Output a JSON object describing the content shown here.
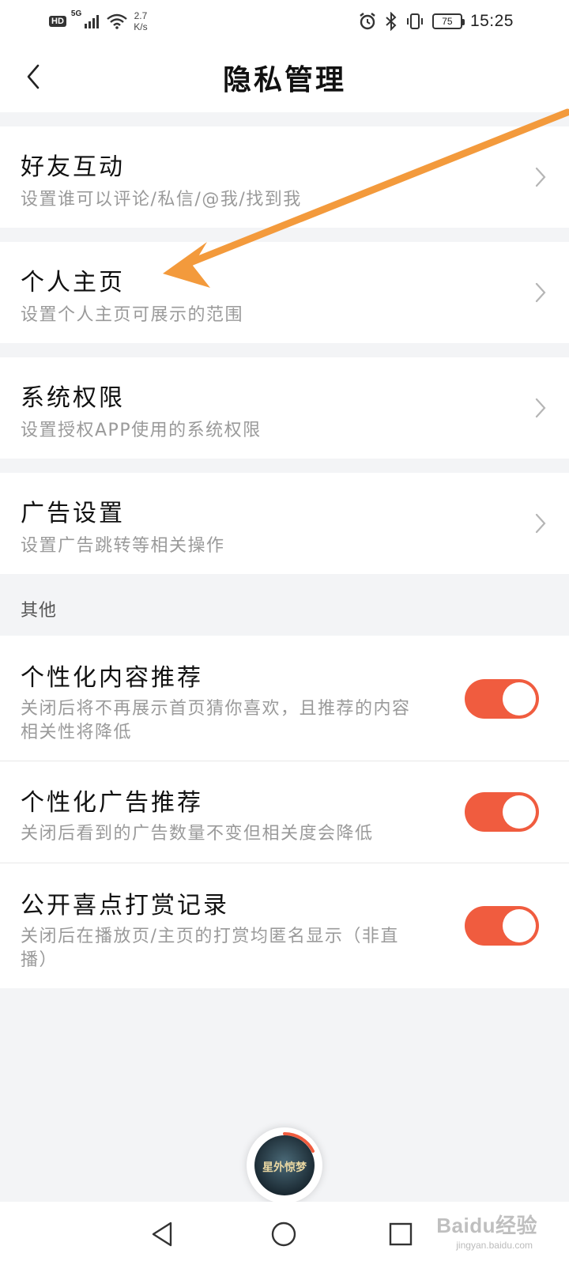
{
  "status_bar": {
    "hd": "HD",
    "signal_label": "5G",
    "net_speed_value": "2.7",
    "net_speed_unit": "K/s",
    "battery": "75",
    "time": "15:25"
  },
  "header": {
    "title": "隐私管理"
  },
  "menu": [
    {
      "title": "好友互动",
      "subtitle": "设置谁可以评论/私信/@我/找到我"
    },
    {
      "title": "个人主页",
      "subtitle": "设置个人主页可展示的范围"
    },
    {
      "title": "系统权限",
      "subtitle": "设置授权APP使用的系统权限"
    },
    {
      "title": "广告设置",
      "subtitle": "设置广告跳转等相关操作"
    }
  ],
  "other_section": {
    "label": "其他",
    "toggles": [
      {
        "title": "个性化内容推荐",
        "subtitle_line1": "关闭后将不再展示首页猜你喜欢，且推荐的内容",
        "subtitle_line2": "相关性将降低",
        "on": true
      },
      {
        "title": "个性化广告推荐",
        "subtitle_line1": "关闭后看到的广告数量不变但相关度会降低",
        "subtitle_line2": "",
        "on": true
      },
      {
        "title": "公开喜点打赏记录",
        "subtitle_line1": "关闭后在播放页/主页的打赏均匿名显示（非直",
        "subtitle_line2": "播）",
        "on": true
      }
    ]
  },
  "floating_player": {
    "cover_text": "星外惊梦"
  },
  "watermark": {
    "brand": "Baidu经验",
    "url": "jingyan.baidu.com"
  },
  "colors": {
    "accent": "#f05c3f",
    "annotation_arrow": "#f39a3c"
  }
}
